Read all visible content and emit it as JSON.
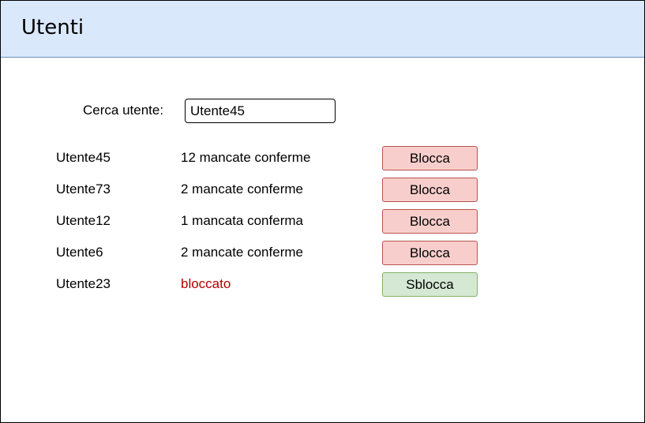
{
  "header": {
    "title": "Utenti"
  },
  "search": {
    "label": "Cerca utente:",
    "value": "Utente45"
  },
  "users": [
    {
      "name": "Utente45",
      "status": "12 mancate conferme",
      "action": "Blocca"
    },
    {
      "name": "Utente73",
      "status": "2 mancate conferme",
      "action": "Blocca"
    },
    {
      "name": "Utente12",
      "status": "1 mancata conferma",
      "action": "Blocca"
    },
    {
      "name": "Utente6",
      "status": "2 mancate conferme",
      "action": "Blocca"
    },
    {
      "name": "Utente23",
      "status": "bloccato",
      "action": "Sblocca"
    }
  ],
  "colors": {
    "header_bg": "#dae8fc",
    "header_border": "#6c8ebf",
    "block_button_bg": "#f8cecc",
    "block_button_border": "#b85450",
    "unblock_button_bg": "#d5e8d4",
    "unblock_button_border": "#82b366",
    "blocked_status_text": "#b20000"
  }
}
